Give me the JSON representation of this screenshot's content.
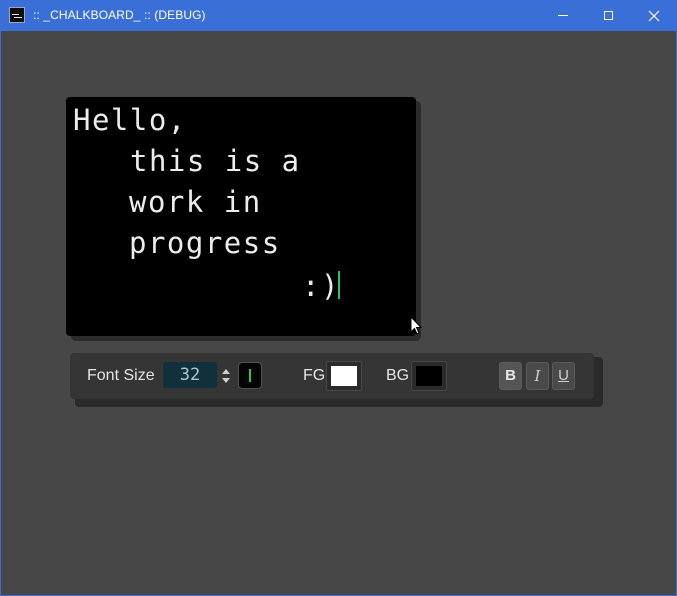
{
  "window": {
    "title": ":: _CHALKBOARD_ :: (DEBUG)",
    "icon": "chalkboard-app-icon",
    "controls": {
      "minimize_icon": "minimize-icon",
      "maximize_icon": "maximize-icon",
      "close_icon": "close-icon"
    }
  },
  "board": {
    "lines": [
      "Hello,",
      "this is a",
      "work in",
      "progress",
      ":)"
    ],
    "text_color": "#ececec",
    "background": "#000000",
    "caret_color": "#23c55e"
  },
  "toolbar": {
    "font_size_label": "Font Size",
    "font_size_value": "32",
    "caret_color": "#27c85e",
    "fg_label": "FG",
    "fg_color": "#ffffff",
    "bg_label": "BG",
    "bg_color": "#000000",
    "bold_label": "B",
    "italic_label": "I",
    "underline_label": "U"
  },
  "colors": {
    "titlebar": "#3a6fd8",
    "background": "#474747",
    "toolbar": "#353535",
    "input_bg": "#10303b"
  }
}
